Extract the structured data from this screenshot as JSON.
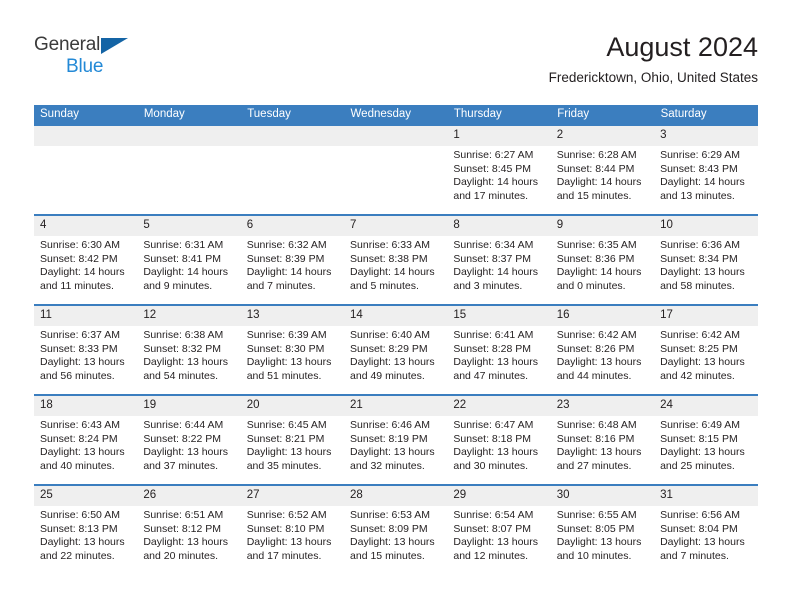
{
  "brand": {
    "line1": "General",
    "line2": "Blue",
    "triangle_color": "#1464a5",
    "blue_text_color": "#2389d6"
  },
  "header": {
    "title": "August 2024",
    "subtitle": "Fredericktown, Ohio, United States"
  },
  "theme": {
    "header_blue": "#3b7ebf",
    "daynum_bg": "#efefef",
    "text": "#231f20"
  },
  "weekday_headers": [
    "Sunday",
    "Monday",
    "Tuesday",
    "Wednesday",
    "Thursday",
    "Friday",
    "Saturday"
  ],
  "weeks": [
    [
      {
        "day": "",
        "sunrise": "",
        "sunset": "",
        "daylight_line1": "",
        "daylight_line2": ""
      },
      {
        "day": "",
        "sunrise": "",
        "sunset": "",
        "daylight_line1": "",
        "daylight_line2": ""
      },
      {
        "day": "",
        "sunrise": "",
        "sunset": "",
        "daylight_line1": "",
        "daylight_line2": ""
      },
      {
        "day": "",
        "sunrise": "",
        "sunset": "",
        "daylight_line1": "",
        "daylight_line2": ""
      },
      {
        "day": "1",
        "sunrise": "Sunrise: 6:27 AM",
        "sunset": "Sunset: 8:45 PM",
        "daylight_line1": "Daylight: 14 hours",
        "daylight_line2": "and 17 minutes."
      },
      {
        "day": "2",
        "sunrise": "Sunrise: 6:28 AM",
        "sunset": "Sunset: 8:44 PM",
        "daylight_line1": "Daylight: 14 hours",
        "daylight_line2": "and 15 minutes."
      },
      {
        "day": "3",
        "sunrise": "Sunrise: 6:29 AM",
        "sunset": "Sunset: 8:43 PM",
        "daylight_line1": "Daylight: 14 hours",
        "daylight_line2": "and 13 minutes."
      }
    ],
    [
      {
        "day": "4",
        "sunrise": "Sunrise: 6:30 AM",
        "sunset": "Sunset: 8:42 PM",
        "daylight_line1": "Daylight: 14 hours",
        "daylight_line2": "and 11 minutes."
      },
      {
        "day": "5",
        "sunrise": "Sunrise: 6:31 AM",
        "sunset": "Sunset: 8:41 PM",
        "daylight_line1": "Daylight: 14 hours",
        "daylight_line2": "and 9 minutes."
      },
      {
        "day": "6",
        "sunrise": "Sunrise: 6:32 AM",
        "sunset": "Sunset: 8:39 PM",
        "daylight_line1": "Daylight: 14 hours",
        "daylight_line2": "and 7 minutes."
      },
      {
        "day": "7",
        "sunrise": "Sunrise: 6:33 AM",
        "sunset": "Sunset: 8:38 PM",
        "daylight_line1": "Daylight: 14 hours",
        "daylight_line2": "and 5 minutes."
      },
      {
        "day": "8",
        "sunrise": "Sunrise: 6:34 AM",
        "sunset": "Sunset: 8:37 PM",
        "daylight_line1": "Daylight: 14 hours",
        "daylight_line2": "and 3 minutes."
      },
      {
        "day": "9",
        "sunrise": "Sunrise: 6:35 AM",
        "sunset": "Sunset: 8:36 PM",
        "daylight_line1": "Daylight: 14 hours",
        "daylight_line2": "and 0 minutes."
      },
      {
        "day": "10",
        "sunrise": "Sunrise: 6:36 AM",
        "sunset": "Sunset: 8:34 PM",
        "daylight_line1": "Daylight: 13 hours",
        "daylight_line2": "and 58 minutes."
      }
    ],
    [
      {
        "day": "11",
        "sunrise": "Sunrise: 6:37 AM",
        "sunset": "Sunset: 8:33 PM",
        "daylight_line1": "Daylight: 13 hours",
        "daylight_line2": "and 56 minutes."
      },
      {
        "day": "12",
        "sunrise": "Sunrise: 6:38 AM",
        "sunset": "Sunset: 8:32 PM",
        "daylight_line1": "Daylight: 13 hours",
        "daylight_line2": "and 54 minutes."
      },
      {
        "day": "13",
        "sunrise": "Sunrise: 6:39 AM",
        "sunset": "Sunset: 8:30 PM",
        "daylight_line1": "Daylight: 13 hours",
        "daylight_line2": "and 51 minutes."
      },
      {
        "day": "14",
        "sunrise": "Sunrise: 6:40 AM",
        "sunset": "Sunset: 8:29 PM",
        "daylight_line1": "Daylight: 13 hours",
        "daylight_line2": "and 49 minutes."
      },
      {
        "day": "15",
        "sunrise": "Sunrise: 6:41 AM",
        "sunset": "Sunset: 8:28 PM",
        "daylight_line1": "Daylight: 13 hours",
        "daylight_line2": "and 47 minutes."
      },
      {
        "day": "16",
        "sunrise": "Sunrise: 6:42 AM",
        "sunset": "Sunset: 8:26 PM",
        "daylight_line1": "Daylight: 13 hours",
        "daylight_line2": "and 44 minutes."
      },
      {
        "day": "17",
        "sunrise": "Sunrise: 6:42 AM",
        "sunset": "Sunset: 8:25 PM",
        "daylight_line1": "Daylight: 13 hours",
        "daylight_line2": "and 42 minutes."
      }
    ],
    [
      {
        "day": "18",
        "sunrise": "Sunrise: 6:43 AM",
        "sunset": "Sunset: 8:24 PM",
        "daylight_line1": "Daylight: 13 hours",
        "daylight_line2": "and 40 minutes."
      },
      {
        "day": "19",
        "sunrise": "Sunrise: 6:44 AM",
        "sunset": "Sunset: 8:22 PM",
        "daylight_line1": "Daylight: 13 hours",
        "daylight_line2": "and 37 minutes."
      },
      {
        "day": "20",
        "sunrise": "Sunrise: 6:45 AM",
        "sunset": "Sunset: 8:21 PM",
        "daylight_line1": "Daylight: 13 hours",
        "daylight_line2": "and 35 minutes."
      },
      {
        "day": "21",
        "sunrise": "Sunrise: 6:46 AM",
        "sunset": "Sunset: 8:19 PM",
        "daylight_line1": "Daylight: 13 hours",
        "daylight_line2": "and 32 minutes."
      },
      {
        "day": "22",
        "sunrise": "Sunrise: 6:47 AM",
        "sunset": "Sunset: 8:18 PM",
        "daylight_line1": "Daylight: 13 hours",
        "daylight_line2": "and 30 minutes."
      },
      {
        "day": "23",
        "sunrise": "Sunrise: 6:48 AM",
        "sunset": "Sunset: 8:16 PM",
        "daylight_line1": "Daylight: 13 hours",
        "daylight_line2": "and 27 minutes."
      },
      {
        "day": "24",
        "sunrise": "Sunrise: 6:49 AM",
        "sunset": "Sunset: 8:15 PM",
        "daylight_line1": "Daylight: 13 hours",
        "daylight_line2": "and 25 minutes."
      }
    ],
    [
      {
        "day": "25",
        "sunrise": "Sunrise: 6:50 AM",
        "sunset": "Sunset: 8:13 PM",
        "daylight_line1": "Daylight: 13 hours",
        "daylight_line2": "and 22 minutes."
      },
      {
        "day": "26",
        "sunrise": "Sunrise: 6:51 AM",
        "sunset": "Sunset: 8:12 PM",
        "daylight_line1": "Daylight: 13 hours",
        "daylight_line2": "and 20 minutes."
      },
      {
        "day": "27",
        "sunrise": "Sunrise: 6:52 AM",
        "sunset": "Sunset: 8:10 PM",
        "daylight_line1": "Daylight: 13 hours",
        "daylight_line2": "and 17 minutes."
      },
      {
        "day": "28",
        "sunrise": "Sunrise: 6:53 AM",
        "sunset": "Sunset: 8:09 PM",
        "daylight_line1": "Daylight: 13 hours",
        "daylight_line2": "and 15 minutes."
      },
      {
        "day": "29",
        "sunrise": "Sunrise: 6:54 AM",
        "sunset": "Sunset: 8:07 PM",
        "daylight_line1": "Daylight: 13 hours",
        "daylight_line2": "and 12 minutes."
      },
      {
        "day": "30",
        "sunrise": "Sunrise: 6:55 AM",
        "sunset": "Sunset: 8:05 PM",
        "daylight_line1": "Daylight: 13 hours",
        "daylight_line2": "and 10 minutes."
      },
      {
        "day": "31",
        "sunrise": "Sunrise: 6:56 AM",
        "sunset": "Sunset: 8:04 PM",
        "daylight_line1": "Daylight: 13 hours",
        "daylight_line2": "and 7 minutes."
      }
    ]
  ]
}
